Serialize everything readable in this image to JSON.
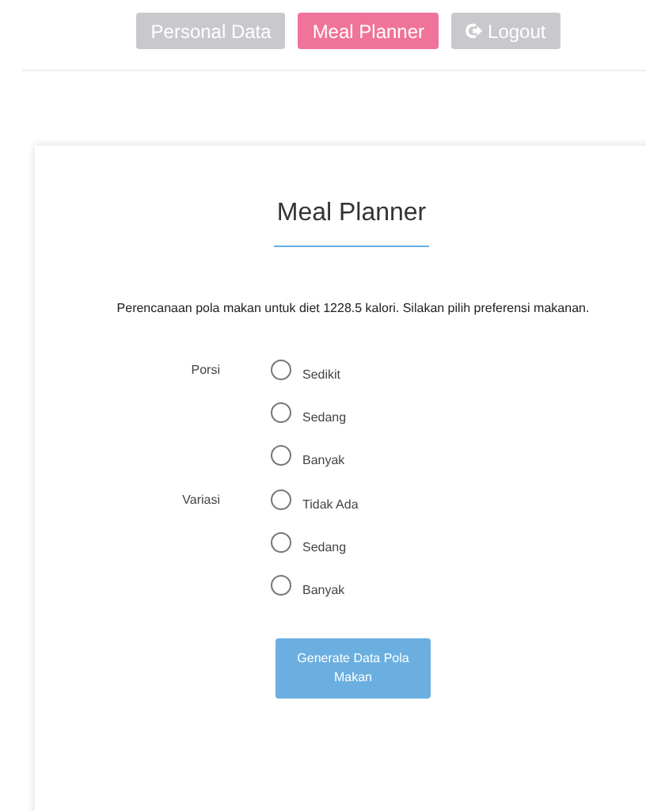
{
  "nav": [
    {
      "label": "Personal Data",
      "selected": false,
      "kind": "text"
    },
    {
      "label": "Meal Planner",
      "selected": true,
      "kind": "text"
    },
    {
      "label": "Logout",
      "selected": false,
      "kind": "logout"
    }
  ],
  "card": {
    "title": "Meal Planner",
    "description": "Perencanaan pola makan untuk diet 1228.5 kalori. Silakan pilih preferensi makanan.",
    "groups": [
      {
        "label": "Porsi",
        "options": [
          {
            "label": "Sedikit",
            "selected": false
          },
          {
            "label": "Sedang",
            "selected": false
          },
          {
            "label": "Banyak",
            "selected": false
          }
        ]
      },
      {
        "label": "Variasi",
        "options": [
          {
            "label": "Tidak Ada",
            "selected": false
          },
          {
            "label": "Sedang",
            "selected": false
          },
          {
            "label": "Banyak",
            "selected": false
          }
        ]
      }
    ],
    "button": "Generate Data Pola Makan"
  }
}
